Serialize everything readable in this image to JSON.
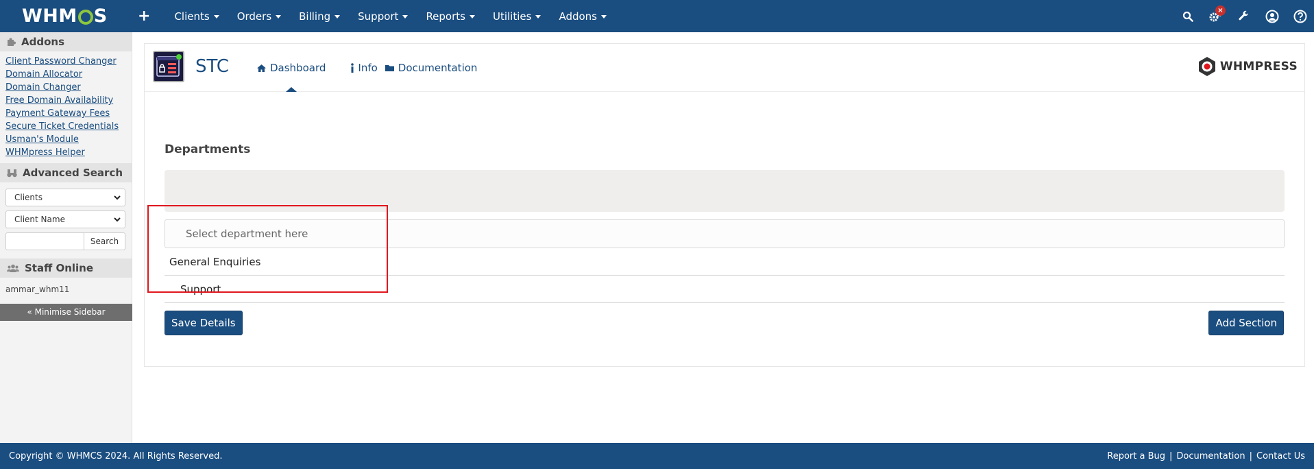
{
  "app": {
    "logo_text_left": "WHM",
    "logo_text_right": "S"
  },
  "topnav": {
    "items": [
      {
        "label": "Clients"
      },
      {
        "label": "Orders"
      },
      {
        "label": "Billing"
      },
      {
        "label": "Support"
      },
      {
        "label": "Reports"
      },
      {
        "label": "Utilities"
      },
      {
        "label": "Addons"
      }
    ],
    "badge": "×"
  },
  "sidebar": {
    "addons_title": "Addons",
    "addons": [
      "Client Password Changer",
      "Domain Allocator",
      "Domain Changer",
      "Free Domain Availability",
      "Payment Gateway Fees",
      "Secure Ticket Credentials",
      "Usman's Module",
      "WHMpress Helper"
    ],
    "advanced_search_title": "Advanced Search",
    "search_type": "Clients",
    "search_field": "Client Name",
    "search_button": "Search",
    "staff_title": "Staff Online",
    "staff_name": "ammar_whm11",
    "minimise": "« Minimise Sidebar"
  },
  "module": {
    "name": "STC",
    "tabs": [
      {
        "label": "Dashboard"
      },
      {
        "label": "Info"
      },
      {
        "label": "Documentation"
      }
    ],
    "brand": "WHMPRESS"
  },
  "content": {
    "departments_title": "Departments",
    "dropdown_placeholder": "Select department here",
    "options": [
      "General Enquiries",
      "Support"
    ],
    "save_button": "Save Details",
    "add_button": "Add Section"
  },
  "footer": {
    "copyright": "Copyright © WHMCS 2024. All Rights Reserved.",
    "links": [
      "Report a Bug",
      "Documentation",
      "Contact Us"
    ],
    "separator": "|"
  },
  "colors": {
    "primary": "#1a4d80",
    "highlight": "#e0161e",
    "badge": "#c9302c",
    "logo_accent": "#8dc63f"
  }
}
